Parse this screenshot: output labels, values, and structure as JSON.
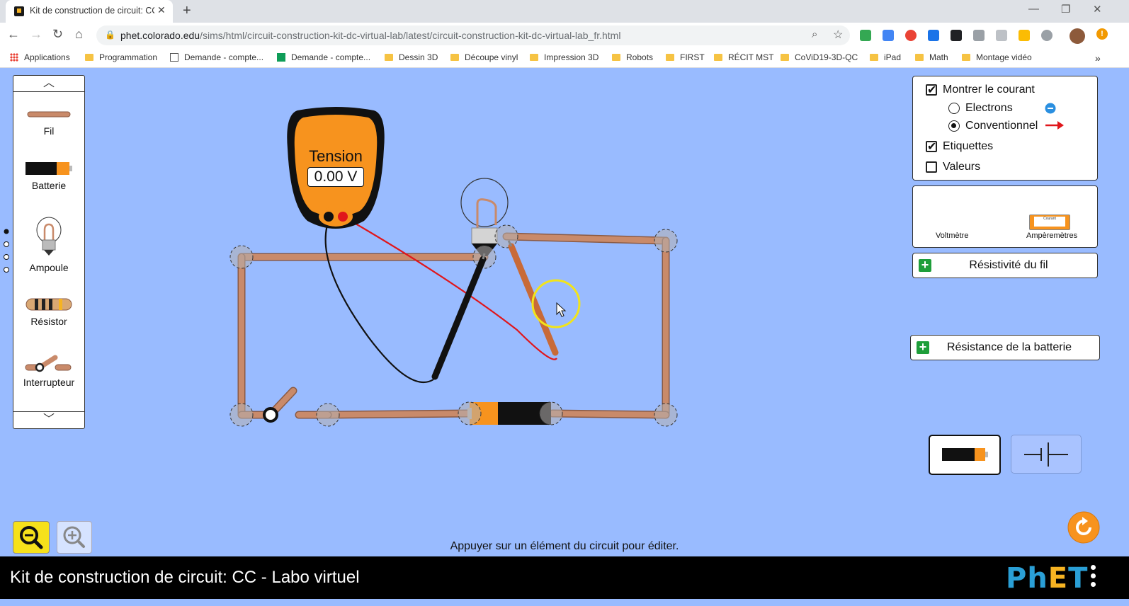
{
  "browser": {
    "tab_title": "Kit de construction de circuit: CC",
    "url_host": "phet.colorado.edu",
    "url_path": "/sims/html/circuit-construction-kit-dc-virtual-lab/latest/circuit-construction-kit-dc-virtual-lab_fr.html",
    "bookmarks": [
      "Applications",
      "Programmation",
      "Demande - compte...",
      "Demande - compte...",
      "Dessin 3D",
      "Découpe vinyl",
      "Impression 3D",
      "Robots",
      "FIRST",
      "RÉCIT MST",
      "CoViD19-3D-QC",
      "iPad",
      "Math",
      "Montage vidéo"
    ]
  },
  "toolbox": {
    "items": [
      "Fil",
      "Batterie",
      "Ampoule",
      "Résistor",
      "Interrupteur"
    ]
  },
  "voltmeter": {
    "title": "Tension",
    "reading": "0.00 V"
  },
  "view_panel": {
    "show_current": "Montrer le courant",
    "electrons": "Electrons",
    "conventional": "Conventionnel",
    "labels": "Etiquettes",
    "values": "Valeurs",
    "show_current_checked": true,
    "labels_checked": true,
    "values_checked": false,
    "selected_mode": "Conventionnel"
  },
  "sensors": {
    "voltmeter_label": "Voltmètre",
    "ammeter_label": "Ampèremètres",
    "ammeter_mini": "Courant"
  },
  "buttons": {
    "wire_resistivity": "Résistivité du fil",
    "battery_resistance": "Résistance de la batterie"
  },
  "hint": "Appuyer sur un élément du circuit pour éditer.",
  "footer": {
    "title": "Kit de construction de circuit: CC - Labo virtuel",
    "logo": "PhET"
  },
  "colors": {
    "background": "#99bbff",
    "wire": "#c98a6a",
    "meter_orange": "#f7931e",
    "probe_red": "#e0161b",
    "accent_green": "#1e9e3a"
  }
}
